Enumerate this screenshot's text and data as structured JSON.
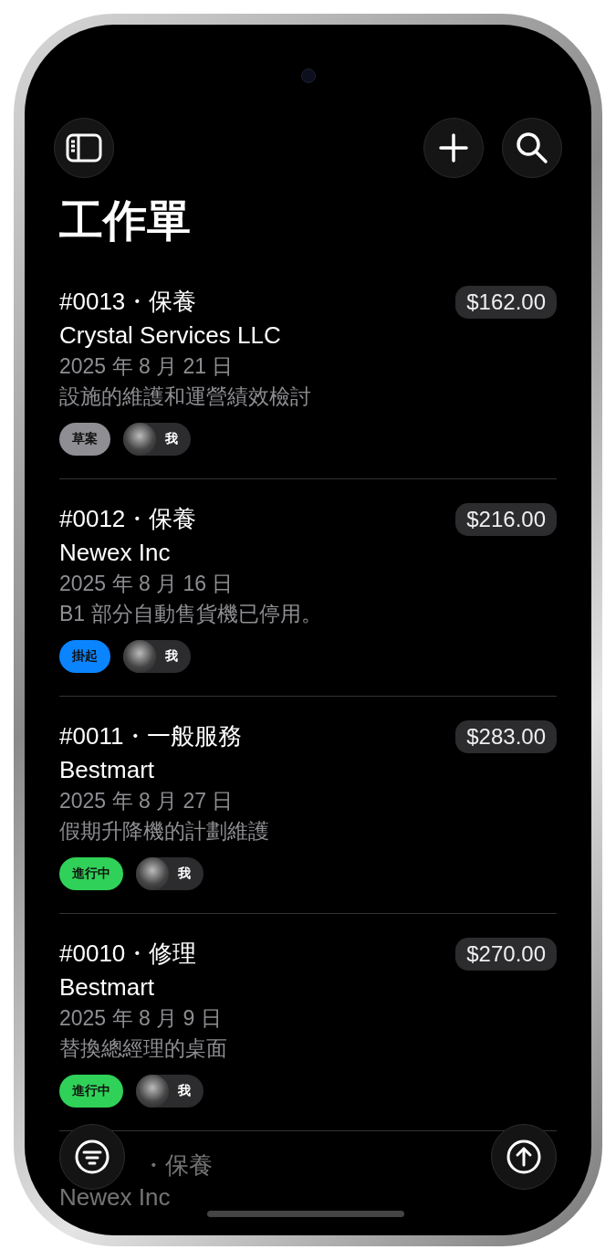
{
  "title": "工作單",
  "orders": [
    {
      "title": "#0013・保養",
      "price": "$162.00",
      "customer": "Crystal Services LLC",
      "date": "2025 年 8 月 21 日",
      "description": "設施的維護和運營績效檢討",
      "status": {
        "label": "草案",
        "color": "#8e8e93"
      },
      "assignee": "我"
    },
    {
      "title": "#0012・保養",
      "price": "$216.00",
      "customer": "Newex Inc",
      "date": "2025 年 8 月 16 日",
      "description": "B1 部分自動售貨機已停用。",
      "status": {
        "label": "掛起",
        "color": "#0a84ff"
      },
      "assignee": "我"
    },
    {
      "title": "#0011・一般服務",
      "price": "$283.00",
      "customer": "Bestmart",
      "date": "2025 年 8 月 27 日",
      "description": "假期升降機的計劃維護",
      "status": {
        "label": "進行中",
        "color": "#30d158"
      },
      "assignee": "我"
    },
    {
      "title": "#0010・修理",
      "price": "$270.00",
      "customer": "Bestmart",
      "date": "2025 年 8 月 9 日",
      "description": "替換總經理的桌面",
      "status": {
        "label": "進行中",
        "color": "#30d158"
      },
      "assignee": "我"
    }
  ],
  "partial_order": {
    "title": "・保養",
    "customer": "Newex Inc"
  }
}
